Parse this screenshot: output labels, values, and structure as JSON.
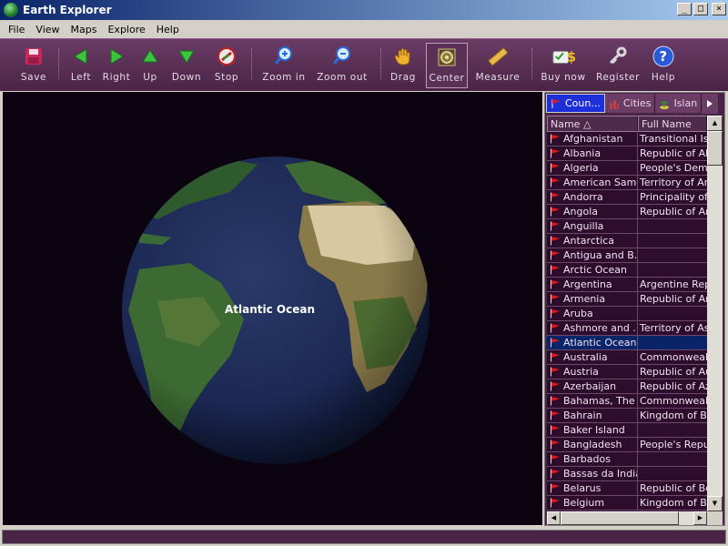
{
  "window": {
    "title": "Earth Explorer"
  },
  "menu": [
    "File",
    "View",
    "Maps",
    "Explore",
    "Help"
  ],
  "toolbar": {
    "save": "Save",
    "left": "Left",
    "right": "Right",
    "up": "Up",
    "down": "Down",
    "stop": "Stop",
    "zoom_in": "Zoom in",
    "zoom_out": "Zoom out",
    "drag": "Drag",
    "center": "Center",
    "measure": "Measure",
    "buy_now": "Buy now",
    "register": "Register",
    "help": "Help"
  },
  "map": {
    "label": "Atlantic Ocean"
  },
  "panel": {
    "tabs": [
      "Coun...",
      "Cities",
      "Islan"
    ],
    "columns": [
      "Name △",
      "Full Name"
    ],
    "rows": [
      [
        "Afghanistan",
        "Transitional Isla"
      ],
      [
        "Albania",
        "Republic of Alb"
      ],
      [
        "Algeria",
        "People's Democ"
      ],
      [
        "American Samoa",
        "Territory of Am"
      ],
      [
        "Andorra",
        "Principality of A"
      ],
      [
        "Angola",
        "Republic of Ang"
      ],
      [
        "Anguilla",
        ""
      ],
      [
        "Antarctica",
        ""
      ],
      [
        "Antigua and B...",
        ""
      ],
      [
        "Arctic Ocean",
        ""
      ],
      [
        "Argentina",
        "Argentine Repu"
      ],
      [
        "Armenia",
        "Republic of Arm"
      ],
      [
        "Aruba",
        ""
      ],
      [
        "Ashmore and ...",
        "Territory of Ash"
      ],
      [
        "Atlantic Ocean",
        ""
      ],
      [
        "Australia",
        "Commonwealth"
      ],
      [
        "Austria",
        "Republic of Aus"
      ],
      [
        "Azerbaijan",
        "Republic of Aze"
      ],
      [
        "Bahamas, The",
        "Commonwealth"
      ],
      [
        "Bahrain",
        "Kingdom of Bah"
      ],
      [
        "Baker Island",
        ""
      ],
      [
        "Bangladesh",
        "People's Repub"
      ],
      [
        "Barbados",
        ""
      ],
      [
        "Bassas da India",
        ""
      ],
      [
        "Belarus",
        "Republic of Bela"
      ],
      [
        "Belgium",
        "Kingdom of Bel"
      ]
    ],
    "selected_row": "Atlantic Ocean"
  },
  "icons": {
    "app": "globe-icon",
    "save": "floppy-disk-icon",
    "left": "arrow-left-icon",
    "right": "arrow-right-icon",
    "up": "arrow-up-icon",
    "down": "arrow-down-icon",
    "stop": "stop-icon",
    "zoom_in": "zoom-in-icon",
    "zoom_out": "zoom-out-icon",
    "drag": "hand-icon",
    "center": "center-target-icon",
    "measure": "ruler-icon",
    "buy_now": "money-icon",
    "register": "key-icon",
    "help": "help-icon",
    "flag": "red-flag-icon"
  },
  "colors": {
    "toolbar": "#4a2446",
    "selection": "#0a246a",
    "tab_selected": "#1c2fd8"
  }
}
